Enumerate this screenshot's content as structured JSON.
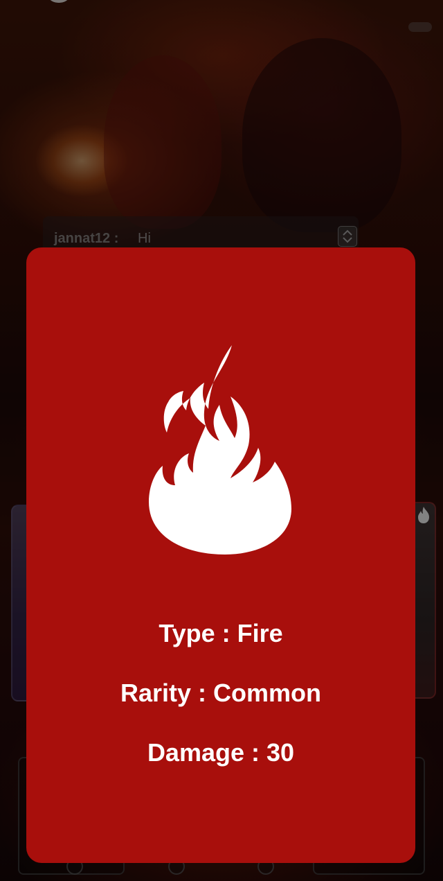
{
  "chat": {
    "username": "jannat12 :",
    "message": "Hi"
  },
  "card_detail": {
    "type_line": "Type : Fire",
    "rarity_line": "Rarity : Common",
    "damage_line": "Damage : 30",
    "icon": "fire-icon",
    "background_color": "#a80f0c",
    "icon_color": "#ffffff"
  }
}
